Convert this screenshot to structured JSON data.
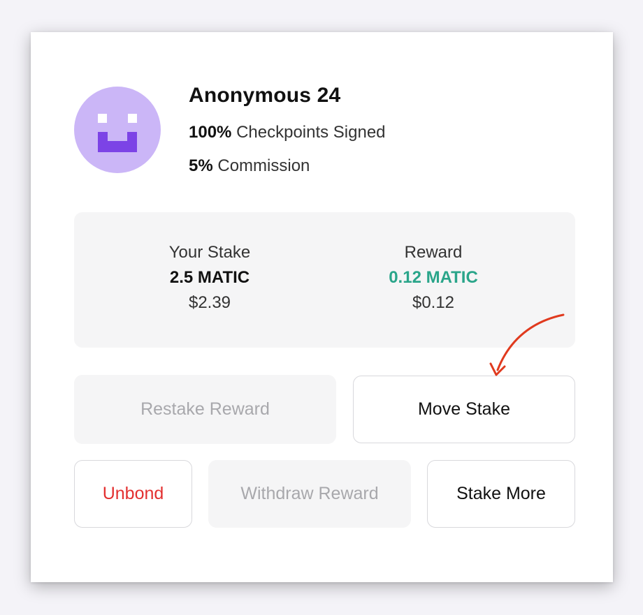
{
  "validator": {
    "name": "Anonymous 24",
    "checkpoints_value": "100%",
    "checkpoints_label": "Checkpoints Signed",
    "commission_value": "5%",
    "commission_label": "Commission"
  },
  "summary": {
    "stake": {
      "label": "Your Stake",
      "amount": "2.5 MATIC",
      "usd": "$2.39"
    },
    "reward": {
      "label": "Reward",
      "amount": "0.12 MATIC",
      "usd": "$0.12"
    }
  },
  "actions": {
    "restake_reward": "Restake Reward",
    "move_stake": "Move Stake",
    "unbond": "Unbond",
    "withdraw_reward": "Withdraw Reward",
    "stake_more": "Stake More"
  },
  "icons": {
    "avatar": "pixel-face-icon",
    "annotation": "red-curved-arrow-icon"
  },
  "colors": {
    "avatar_bg": "#cbb6f7",
    "avatar_face": "#7c43e6",
    "reward_green": "#2aa58a",
    "unbond_red": "#e33030",
    "annotation_red": "#e03a1e"
  }
}
